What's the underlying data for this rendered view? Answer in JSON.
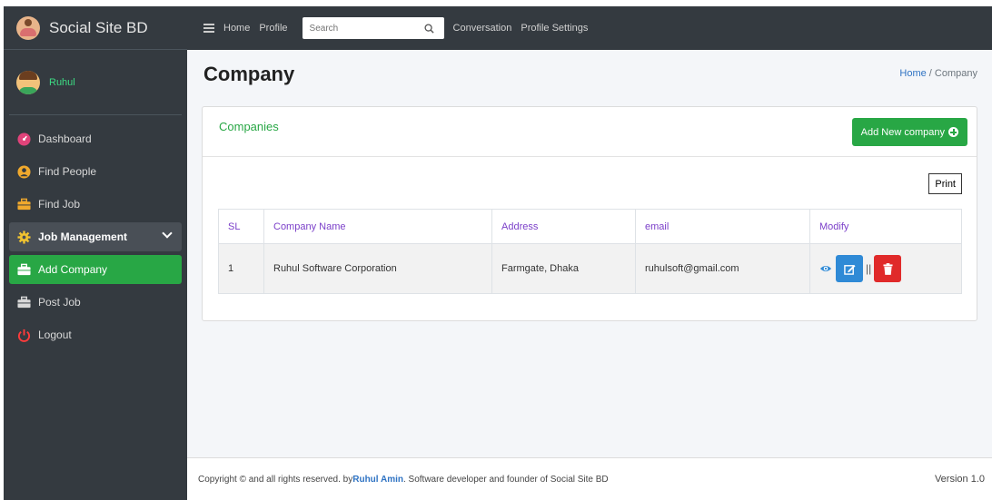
{
  "brand": {
    "title": "Social Site BD"
  },
  "user": {
    "name": "Ruhul"
  },
  "sidebar": {
    "items": [
      {
        "label": "Dashboard",
        "icon": "dashboard-icon"
      },
      {
        "label": "Find People",
        "icon": "user-circle-icon"
      },
      {
        "label": "Find Job",
        "icon": "briefcase-icon"
      },
      {
        "label": "Job Management",
        "icon": "gear-icon"
      },
      {
        "label": "Add Company",
        "icon": "briefcase-icon"
      },
      {
        "label": "Post Job",
        "icon": "briefcase-icon"
      },
      {
        "label": "Logout",
        "icon": "power-icon"
      }
    ]
  },
  "topbar": {
    "home": "Home",
    "profile": "Profile",
    "search_placeholder": "Search",
    "conversation": "Conversation",
    "profile_settings": "Profile Settings"
  },
  "page": {
    "title": "Company",
    "breadcrumb_home": "Home",
    "breadcrumb_sep": "/",
    "breadcrumb_current": "Company"
  },
  "card": {
    "title": "Companies",
    "add_button": "Add New company",
    "print_button": "Print"
  },
  "table": {
    "headers": [
      "SL",
      "Company Name",
      "Address",
      "email",
      "Modify"
    ],
    "rows": [
      {
        "sl": "1",
        "name": "Ruhul Software Corporation",
        "address": "Farmgate, Dhaka",
        "email": "ruhulsoft@gmail.com",
        "sep": "||"
      }
    ]
  },
  "footer": {
    "prefix": "Copyright © and all rights reserved. by ",
    "author": "Ruhul Amin",
    "suffix": ". Software developer and founder of Social Site BD",
    "version": "Version 1.0"
  },
  "colors": {
    "accent": "#28a745",
    "header_text": "#7b3fc9",
    "edit": "#2f8ad6",
    "delete": "#e02a2a",
    "sidebar": "#343a40"
  }
}
